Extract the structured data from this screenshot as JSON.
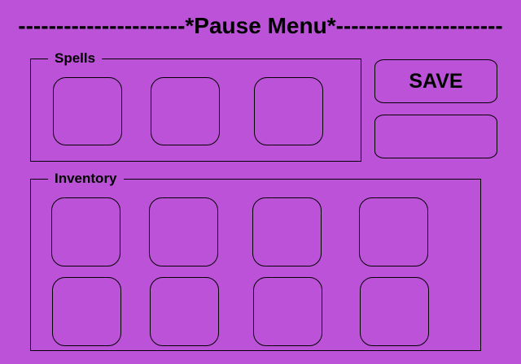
{
  "theme": {
    "background": "#bb52d8",
    "line": "#000000"
  },
  "header": {
    "title": "----------------------*Pause Menu*----------------------"
  },
  "spells": {
    "label": "Spells",
    "slot_count": 3
  },
  "inventory": {
    "label": "Inventory",
    "slot_count": 8
  },
  "actions": {
    "save_label": "SAVE",
    "second_label": ""
  }
}
